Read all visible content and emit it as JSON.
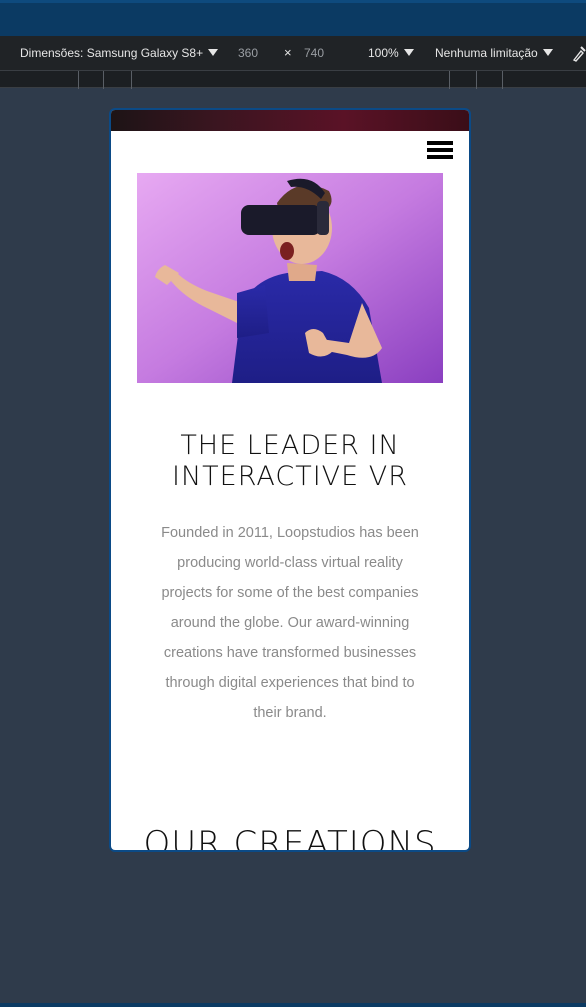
{
  "devtools": {
    "device_label": "Dimensões: Samsung Galaxy S8+",
    "width": "360",
    "times": "×",
    "height": "740",
    "zoom": "100%",
    "throttle": "Nenhuma limitação"
  },
  "page": {
    "headline": "THE LEADER IN INTERACTIVE VR",
    "body": "Founded in 2011, Loopstudios has been producing world-class virtual reality projects for some of the best companies around the globe. Our award-winning creations have transformed businesses through digital experiences that bind to their brand.",
    "section_title": "OUR CREATIONS"
  },
  "colors": {
    "accent_border": "#0b4a86",
    "text_grey": "#8a8a8a"
  }
}
